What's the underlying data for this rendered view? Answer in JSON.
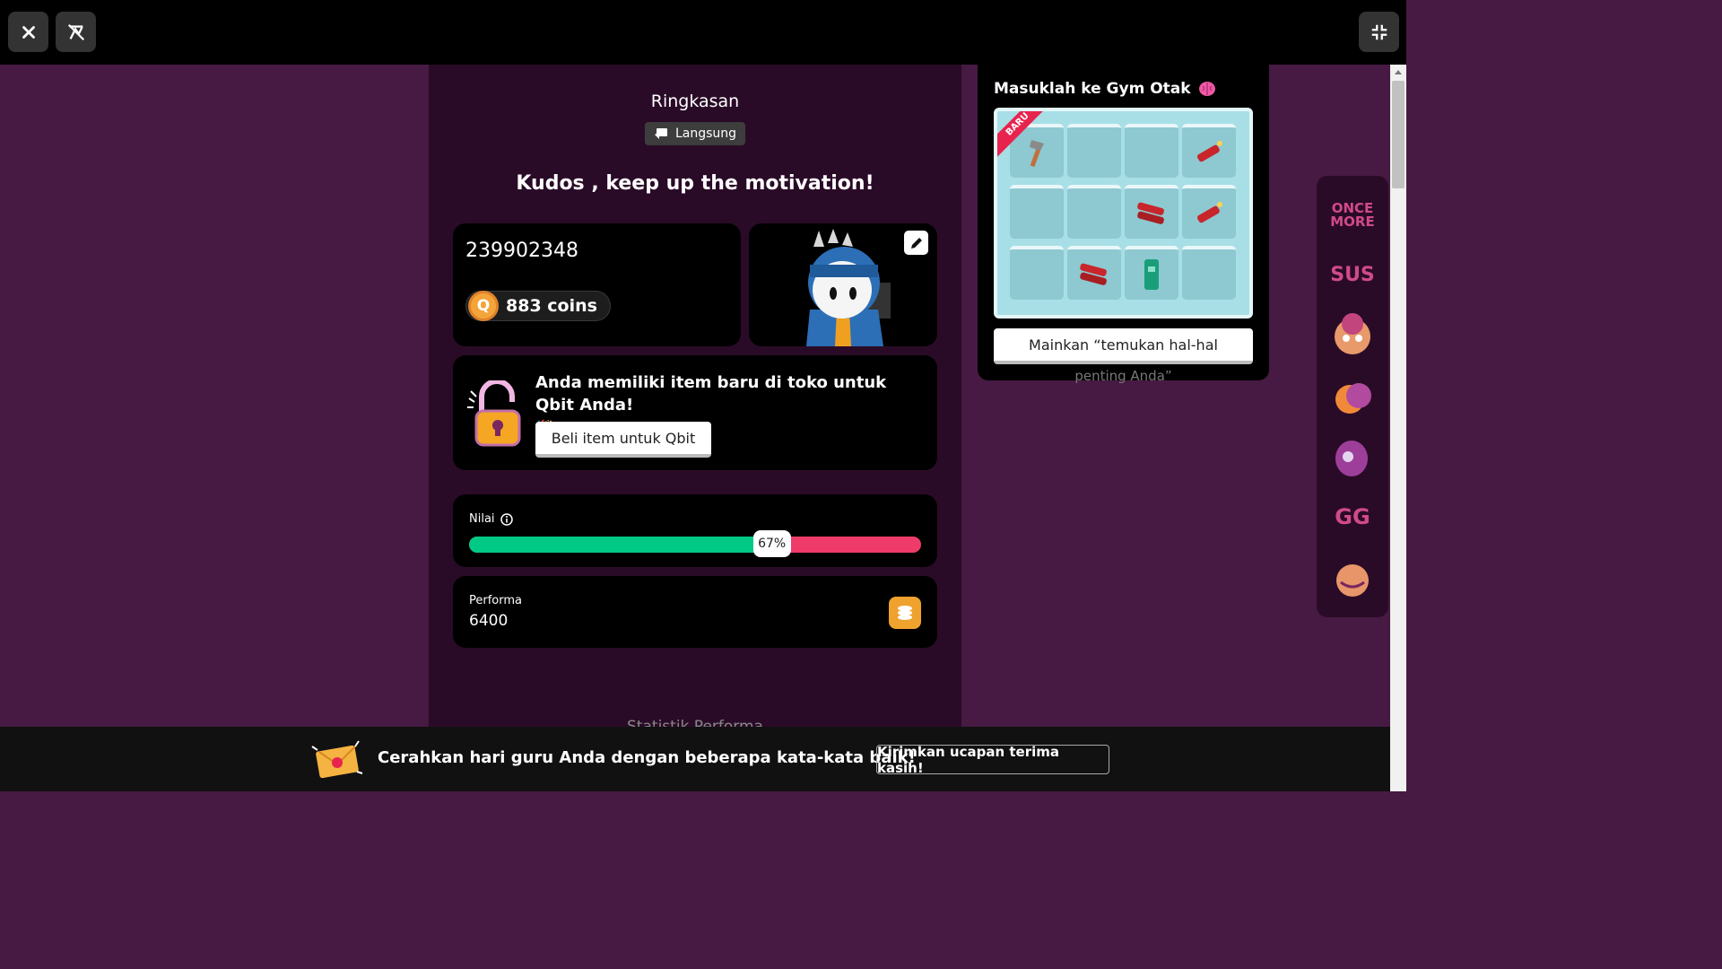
{
  "topbar": {
    "close_icon": "close-icon",
    "mute_icon": "music-off-icon",
    "fullscreen_icon": "exit-fullscreen-icon"
  },
  "summary": {
    "title": "Ringkasan",
    "live_label": "Langsung",
    "heading": "Kudos , keep up the motivation!"
  },
  "user": {
    "id": "239902348",
    "coins_label": "883 coins"
  },
  "shop": {
    "message": "Anda memiliki item baru di toko untuk Qbit Anda!",
    "button_label": "Beli item untuk Qbit"
  },
  "score": {
    "label": "Nilai",
    "percent_label": "67%",
    "percent": 0.67,
    "correct_color": "#00c985",
    "wrong_color": "#ef3b69"
  },
  "performance": {
    "label": "Performa",
    "value": "6400"
  },
  "stats_title": "Statistik Performa",
  "gym": {
    "title": "Masuklah ke Gym Otak",
    "new_badge": "BARU",
    "button_label": "Mainkan “temukan hal-hal",
    "button_overflow": "penting Anda”"
  },
  "stickers": [
    "ONCE MORE",
    "SUS",
    "mind-blown",
    "speed",
    "nerd",
    "GG",
    "yummy"
  ],
  "banner": {
    "message": "Cerahkan hari guru Anda dengan beberapa kata-kata baik!",
    "button_label": "Kirimkan ucapan terima kasih!"
  }
}
